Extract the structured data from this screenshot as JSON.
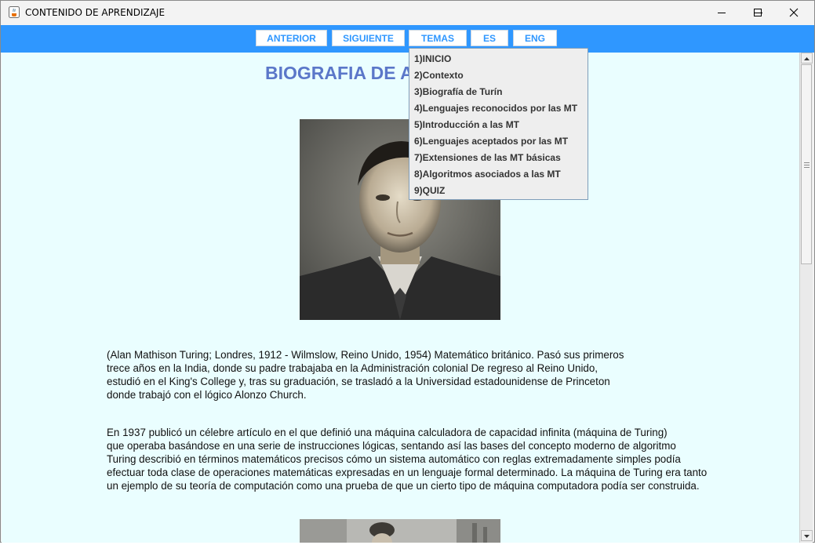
{
  "window": {
    "title": "CONTENIDO DE APRENDIZAJE"
  },
  "toolbar": {
    "prev_label": "ANTERIOR",
    "next_label": "SIGUIENTE",
    "topics_label": "TEMAS",
    "es_label": "ES",
    "eng_label": "ENG"
  },
  "menu": {
    "items": [
      "1)INICIO",
      "2)Contexto",
      "3)Biografía de Turín",
      "4)Lenguajes reconocidos por las MT",
      "5)Introducción a las MT",
      "6)Lenguajes aceptados por las MT",
      "7)Extensiones de las MT básicas",
      "8)Algoritmos asociados a las MT",
      "9)QUIZ"
    ]
  },
  "content": {
    "heading": "BIOGRAFIA DE ALAN TURING",
    "paragraph1": [
      "(Alan Mathison Turing; Londres, 1912 - Wilmslow, Reino Unido, 1954) Matemático británico. Pasó sus primeros",
      "trece años en la India, donde su padre trabajaba en la Administración colonial De regreso al Reino Unido,",
      "estudió en el King's College y, tras su graduación, se trasladó a la Universidad estadounidense de Princeton",
      "donde trabajó con el lógico Alonzo Church."
    ],
    "paragraph2": [
      "En 1937 publicó un célebre artículo en el que definió una máquina calculadora de capacidad infinita (máquina de Turing)",
      "que operaba basándose en una serie de instrucciones lógicas, sentando así las bases del concepto moderno de algoritmo",
      "Turing describió en términos matemáticos precisos cómo un sistema automático con reglas extremadamente simples podía",
      "efectuar toda clase de operaciones matemáticas expresadas en un lenguaje formal determinado. La máquina de Turing era tanto",
      "un ejemplo de su teoría de computación como una prueba de que un cierto tipo de máquina computadora podía ser construida."
    ]
  },
  "colors": {
    "toolbar": "#2f97ff",
    "content_bg": "#eafeff",
    "heading": "#5b77c9"
  }
}
